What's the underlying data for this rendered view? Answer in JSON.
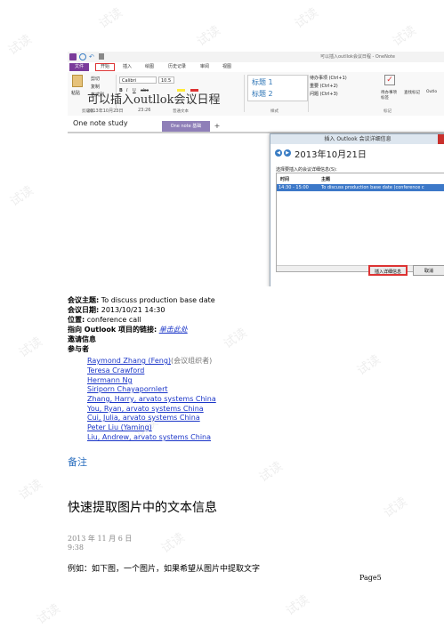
{
  "onenote": {
    "window_title": "可以插入outllok会议日程 - OneNote",
    "tabs": [
      "文件",
      "开始",
      "插入",
      "绘图",
      "历史记录",
      "审阅",
      "视图"
    ],
    "active_tab_index": 1,
    "clipboard": {
      "paste": "粘贴",
      "cut": "剪切",
      "copy": "复制",
      "format_painter": "格式刷",
      "group": "剪贴板"
    },
    "font": {
      "name": "Calibri",
      "size": "10.5",
      "group": "普通文本"
    },
    "styles": {
      "heading1": "标题 1",
      "heading2": "标题 2",
      "group": "样式"
    },
    "tags": {
      "todo": "待办事项 (Ctrl+1)",
      "important": "重要 (Ctrl+2)",
      "question": "问题 (Ctrl+3)",
      "group": "标记"
    },
    "todo_tag_button": "待办事项\n标签",
    "find_tags": "查找标记",
    "outlook": "Outlo",
    "notebook_name": "One note study",
    "section_tab": "One note 基础",
    "page_title": "可以插入outllok会议日程",
    "page_date": "2013年10月23日",
    "page_time": "23:26"
  },
  "dialog": {
    "title": "插入 Outlook 会议详细信息",
    "date": "2013年10月21日",
    "label": "选择要插入的会议详细信息(S):",
    "col_time": "时间",
    "col_subject": "主题",
    "row_time": "14:30 - 15:00",
    "row_subject": "To discuss production base date (conference c",
    "insert_button": "插入详细信息",
    "cancel_button": "取消"
  },
  "meeting": {
    "subject_label": "会议主题:",
    "subject": " To discuss production base date",
    "date_label": "会议日期:",
    "date": " 2013/10/21 14:30",
    "location_label": "位置:",
    "location": " conference call",
    "link_label": "指向 Outlook 项目的链接:",
    "link_text": "单击此处",
    "invite_label": "邀请信息",
    "attendees_label": "参与者",
    "attendees": [
      "Raymond Zhang (Feng)",
      "Teresa Crawford",
      "Hermann Ng",
      "Siriporn Chayapornlert",
      "Zhang, Harry, arvato systems China",
      "You, Ryan, arvato systems China",
      "Cui, Julia, arvato systems China",
      "Peter Liu (Yaming)",
      "Liu, Andrew, arvato systems China"
    ],
    "organizer_note": " (会议组织者)"
  },
  "notes_heading": "备注",
  "section2": {
    "heading": "快速提取图片中的文本信息",
    "date": "2013 年 11 月 6 日",
    "time": "9:38",
    "body": "例如：如下图，一个图片，如果希望从图片中提取文字"
  },
  "page_number": "Page5",
  "watermark_text": "试读"
}
